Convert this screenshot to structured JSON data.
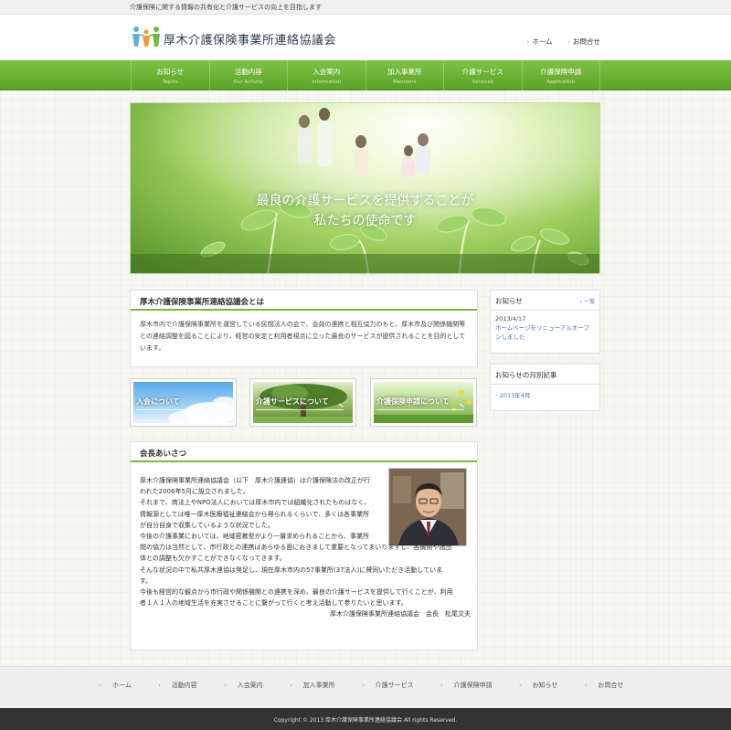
{
  "topbar": {
    "tagline": "介護保険に関する情報の共有化と介護サービスの向上を目指します"
  },
  "header": {
    "site_title": "厚木介護保険事業所連絡協議会",
    "links": [
      {
        "label": "ホーム"
      },
      {
        "label": "お問合せ"
      }
    ]
  },
  "nav": [
    {
      "ja": "お知らせ",
      "en": "Topics"
    },
    {
      "ja": "活動内容",
      "en": "Our Activity"
    },
    {
      "ja": "入会案内",
      "en": "Information"
    },
    {
      "ja": "加入事業所",
      "en": "Members"
    },
    {
      "ja": "介護サービス",
      "en": "Services"
    },
    {
      "ja": "介護保険申請",
      "en": "Application"
    }
  ],
  "hero": {
    "line1": "最良の介護サービスを提供することが",
    "line2": "私たちの使命です"
  },
  "about": {
    "title": "厚木介護保険事業所連絡協議会とは",
    "body": "厚木市内で介護保険事業所を運営している民間法人の会で、会員の連携と相互協力のもと、厚木市及び関係機関等との連絡調整を図ることにより、経営の安定と利用者視点に立った最良のサービスが提供されることを目的としています。"
  },
  "banners": [
    {
      "label": "入会について"
    },
    {
      "label": "介護サービスについて"
    },
    {
      "label": "介護保険申請について"
    }
  ],
  "greeting": {
    "title": "会長あいさつ",
    "lines": [
      "厚木介護保険事業所連絡協議会（以下　厚木介護連協）は介護保険法の改正が行",
      "われた2006年5月に設立されました。",
      "それまで、商法上やNPO法人においては厚木市内では組織化されたものはなく、",
      "情報源としては唯一厚木医療福祉連絡会から得られるくらいで、多くは各事業所",
      "が自分自身で収集しているような状況でした。",
      "今後の介護事業においては、地域密着型がより一層求められることから、事業所",
      "間の協力は当然として、市行政との連携はあらゆる面におきまして重要となってまいりますし、各機関や諸団",
      "体との調整も欠かすことができなくなってきます。",
      "そんな状況の中で私共厚木連協は発足し、現在厚木市内の57事業所(37法人)に賛同いただき活動していま",
      "す。",
      "今後も経営的な観点から市行政や関係機関との連携を深め、最良の介護サービスを提供して行くことが、利用",
      "者１人１人の地域生活を充実させることに繋がって行くと考え活動して参りたいと思います。"
    ],
    "signature": "厚木介護保険事業所連絡協議会　会長　松尾文夫"
  },
  "sidebar": {
    "news": {
      "title": "お知らせ",
      "more": "一覧",
      "date": "2013/4/17",
      "item": "ホームページをリニューアルオープンしました"
    },
    "archive": {
      "title": "お知らせの月別記事",
      "item": "2013年4月"
    }
  },
  "footer": {
    "links": [
      "ホーム",
      "活動内容",
      "入会案内",
      "加入事業所",
      "介護サービス",
      "介護保険申請",
      "お知らせ",
      "お問合せ"
    ],
    "copyright": "Copyright © 2013 厚木介護保険事業所連絡協議会 All rights Reserved."
  },
  "colors": {
    "accent_green": "#6ab032",
    "link_blue": "#3e6fb8",
    "footer_dark": "#333333"
  }
}
